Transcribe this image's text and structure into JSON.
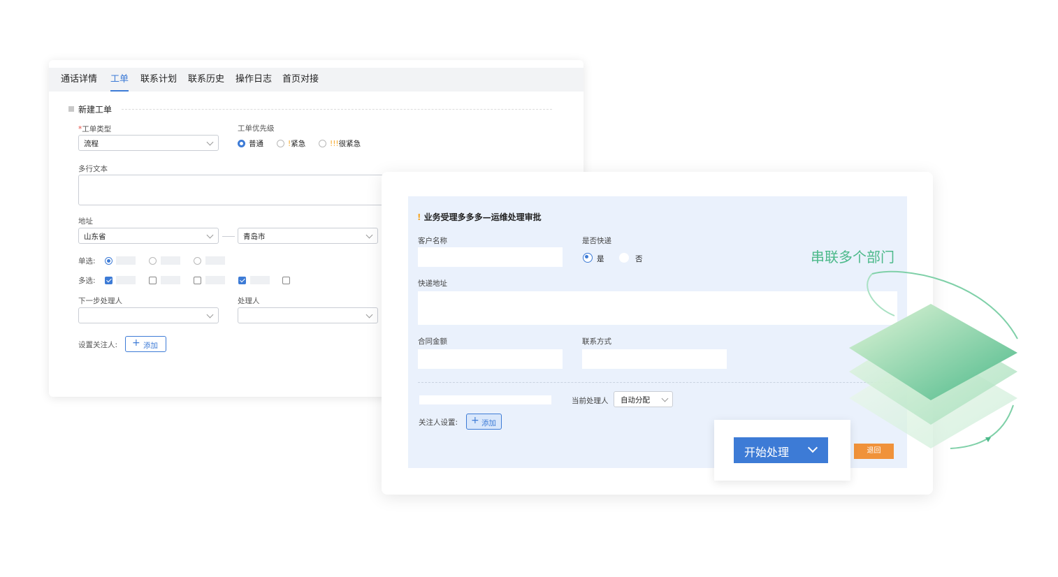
{
  "tabs": [
    "通话详情",
    "工单",
    "联系计划",
    "联系历史",
    "操作日志",
    "首页对接"
  ],
  "active_tab": "工单",
  "section_title": "新建工单",
  "ticket_type": {
    "required_mark": "*",
    "label": "工单类型",
    "value": "流程"
  },
  "priority": {
    "label": "工单优先级",
    "options": [
      {
        "marks": "",
        "text": "普通",
        "selected": true
      },
      {
        "marks": "!",
        "text": "紧急",
        "selected": false
      },
      {
        "marks": "!!!",
        "text": "很紧急",
        "selected": false
      }
    ]
  },
  "multiline": {
    "label": "多行文本"
  },
  "address": {
    "label": "地址",
    "province": "山东省",
    "city": "青岛市"
  },
  "single_choice": {
    "label": "单选:",
    "selected_index": 0
  },
  "multi_choice": {
    "label": "多选:",
    "checked": [
      true,
      false,
      false,
      true,
      false
    ]
  },
  "next_handler": {
    "label": "下一步处理人"
  },
  "handler": {
    "label": "处理人"
  },
  "watchers": {
    "label": "设置关注人:",
    "add_icon": "plus-icon",
    "add_label": "添加"
  },
  "approval": {
    "warning_mark": "!",
    "title": "业务受理多多多—运维处理审批",
    "customer_label": "客户名称",
    "express_label": "是否快递",
    "express_yes": "是",
    "express_no": "否",
    "express_selected": "是",
    "express_address_label": "快递地址",
    "contract_amount_label": "合同金额",
    "contact_label": "联系方式",
    "current_handler_label": "当前处理人",
    "current_handler_value": "自动分配",
    "watchers_label": "关注人设置:",
    "add_label": "添加",
    "return_label": "退回",
    "start_label": "开始处理"
  },
  "tagline": "串联多个部门",
  "colors": {
    "accent": "#3d7bd6",
    "orange": "#f0923a",
    "green": "#4cb98a",
    "panel": "#eaf1fc"
  }
}
